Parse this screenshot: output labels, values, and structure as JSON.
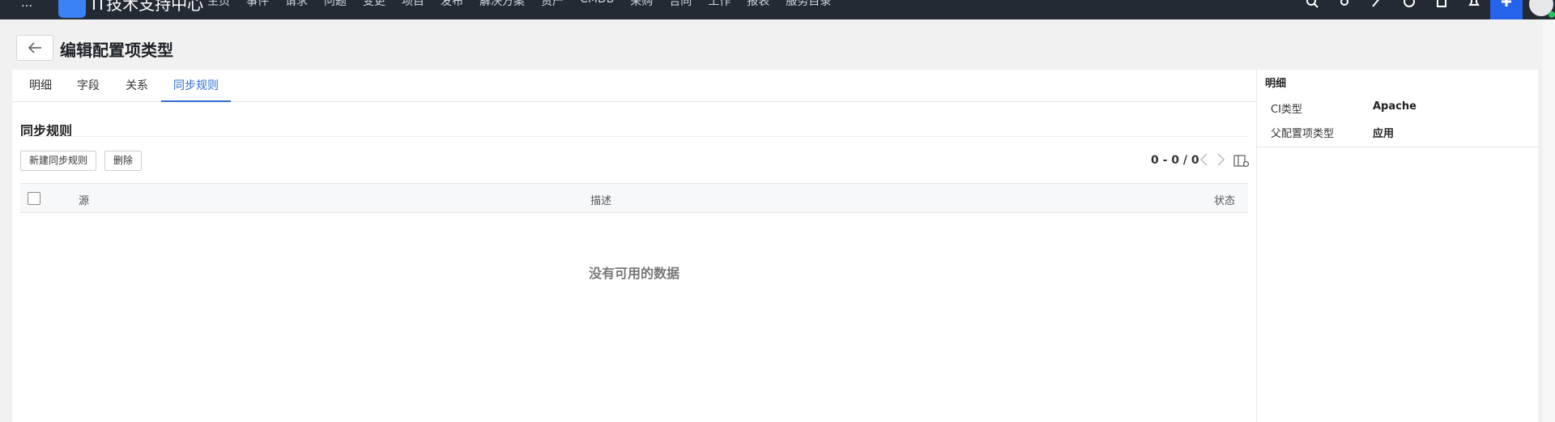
{
  "topbar": {
    "menu_glyph": "…",
    "app_title": "IT技术支持中心",
    "nav": [
      "主页",
      "事件",
      "请求",
      "问题",
      "变更",
      "项目",
      "发布",
      "解决方案",
      "资产",
      "CMDB",
      "采购",
      "合同",
      "工作",
      "报表",
      "服务目录"
    ],
    "icons": [
      "search-icon",
      "settings-icon",
      "send-icon",
      "history-icon",
      "edit-icon",
      "bell-icon",
      "add-icon",
      "avatar"
    ],
    "accent": "#2563eb"
  },
  "header": {
    "back_icon": "arrow-left-icon",
    "title": "编辑配置项类型"
  },
  "tabs": [
    {
      "label": "明细",
      "active": false
    },
    {
      "label": "字段",
      "active": false
    },
    {
      "label": "关系",
      "active": false
    },
    {
      "label": "同步规则",
      "active": true
    }
  ],
  "section": {
    "title": "同步规则",
    "new_button": "新建同步规则",
    "delete_button": "删除",
    "pagination": "0 - 0 / 0",
    "columns": [
      "源",
      "描述",
      "状态"
    ],
    "empty_text": "没有可用的数据"
  },
  "detail": {
    "title": "明细",
    "fields": [
      {
        "label": "CI类型",
        "value": "Apache"
      },
      {
        "label": "父配置项类型",
        "value": "应用"
      }
    ]
  }
}
